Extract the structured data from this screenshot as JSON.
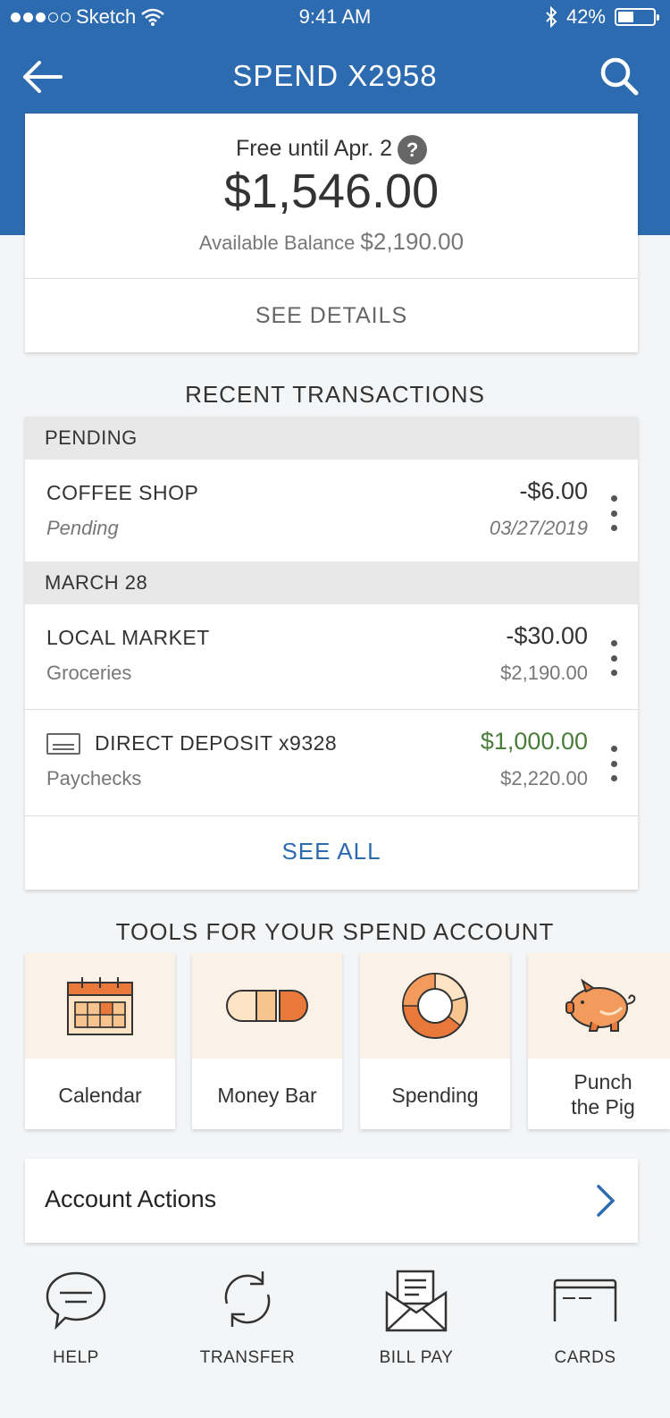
{
  "status_bar": {
    "carrier": "Sketch",
    "time": "9:41 AM",
    "battery": "42%"
  },
  "nav": {
    "title": "SPEND X2958"
  },
  "balance": {
    "free_until": "Free until Apr. 2",
    "help_glyph": "?",
    "amount": "$1,546.00",
    "available_label": "Available Balance",
    "available_amount": "$2,190.00",
    "see_details": "SEE DETAILS"
  },
  "transactions": {
    "title": "RECENT TRANSACTIONS",
    "groups": [
      {
        "header": "PENDING",
        "rows": [
          {
            "name": "COFFEE SHOP",
            "sub": "Pending",
            "amount": "-$6.00",
            "meta": "03/27/2019"
          }
        ]
      },
      {
        "header": "MARCH 28",
        "rows": [
          {
            "name": "LOCAL MARKET",
            "sub": "Groceries",
            "amount": "-$30.00",
            "meta": "$2,190.00"
          },
          {
            "name": "DIRECT DEPOSIT x9328",
            "sub": "Paychecks",
            "amount": "$1,000.00",
            "meta": "$2,220.00"
          }
        ]
      }
    ],
    "see_all": "SEE ALL"
  },
  "tools": {
    "title": "TOOLS FOR YOUR SPEND ACCOUNT",
    "items": [
      {
        "label": "Calendar",
        "icon": "calendar-icon"
      },
      {
        "label": "Money Bar",
        "icon": "money-bar-icon"
      },
      {
        "label": "Spending",
        "icon": "donut-chart-icon"
      },
      {
        "label_line1": "Punch",
        "label_line2": "the Pig",
        "icon": "piggy-bank-icon"
      }
    ]
  },
  "account_actions": {
    "label": "Account Actions"
  },
  "bottom_bar": {
    "items": [
      {
        "label": "HELP",
        "icon": "chat-bubble-icon"
      },
      {
        "label": "TRANSFER",
        "icon": "transfer-icon"
      },
      {
        "label": "BILL PAY",
        "icon": "envelope-icon"
      },
      {
        "label": "CARDS",
        "icon": "card-icon"
      }
    ]
  },
  "colors": {
    "brand_blue": "#2d6bb0",
    "positive_green": "#4b7d3a",
    "tool_orange": "#e8793a",
    "tool_bg": "#fbf2e7"
  }
}
